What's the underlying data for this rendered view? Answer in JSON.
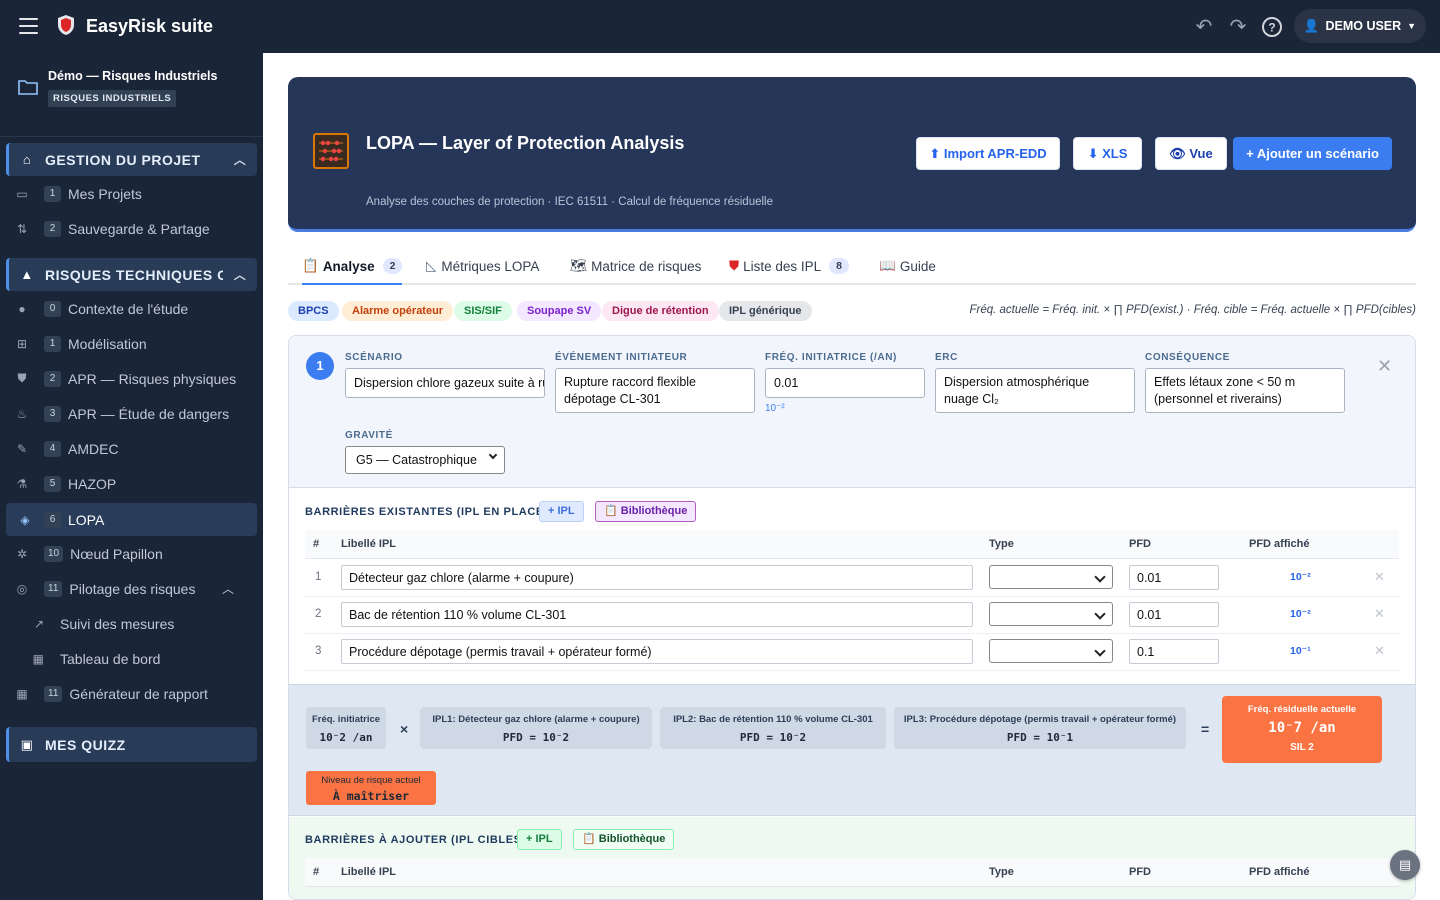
{
  "app": {
    "title": "EasyRisk suite",
    "user": "DEMO USER"
  },
  "project": {
    "name": "Démo — Risques Industriels",
    "badge": "RISQUES INDUSTRIELS"
  },
  "sidebar": {
    "sec1": "GESTION DU PROJET",
    "sec1_items": [
      {
        "num": "1",
        "label": "Mes Projets"
      },
      {
        "num": "2",
        "label": "Sauvegarde & Partage"
      }
    ],
    "sec2": "RISQUES TECHNIQUES O",
    "sec2_items": [
      {
        "num": "0",
        "label": "Contexte de l'étude"
      },
      {
        "num": "1",
        "label": "Modélisation"
      },
      {
        "num": "2",
        "label": "APR — Risques physiques"
      },
      {
        "num": "3",
        "label": "APR — Étude de dangers"
      },
      {
        "num": "4",
        "label": "AMDEC"
      },
      {
        "num": "5",
        "label": "HAZOP"
      },
      {
        "num": "6",
        "label": "LOPA"
      },
      {
        "num": "10",
        "label": "Nœud Papillon"
      },
      {
        "num": "11",
        "label": "Pilotage des risques"
      }
    ],
    "sub_items": [
      "Suivi des mesures",
      "Tableau de bord"
    ],
    "report": {
      "num": "11",
      "label": "Générateur de rapport"
    },
    "sec3": "MES QUIZZ"
  },
  "hero": {
    "title": "LOPA — Layer of Protection Analysis",
    "subtitle": "Analyse des couches de protection · IEC 61511 · Calcul de fréquence résiduelle",
    "buttons": {
      "import": "⬆ Import APR-EDD",
      "xls": "⬇ XLS",
      "vue": "👁 Vue",
      "add": "+ Ajouter un scénario"
    }
  },
  "tabs": [
    {
      "label": "Analyse",
      "count": "2"
    },
    {
      "label": "Métriques LOPA"
    },
    {
      "label": "Matrice de risques"
    },
    {
      "label": "Liste des IPL",
      "count": "8"
    },
    {
      "label": "Guide"
    }
  ],
  "pills": [
    "BPCS",
    "Alarme opérateur",
    "SIS/SIF",
    "Soupape SV",
    "Digue de rétention",
    "IPL générique"
  ],
  "formula": "Fréq. actuelle = Fréq. init. × ∏ PFD(exist.) · Fréq. cible = Fréq. actuelle × ∏ PFD(cibles)",
  "scenario": {
    "num": "1",
    "labels": {
      "scenario": "SCÉNARIO",
      "event": "ÉVÉNEMENT INITIATEUR",
      "freq": "FRÉQ. INITIATRICE (/AN)",
      "erc": "ERC",
      "cons": "CONSÉQUENCE",
      "grav": "GRAVITÉ"
    },
    "scenario_value": "Dispersion chlore gazeux suite à rupture",
    "event_value": "Rupture raccord flexible dépotage CL-301",
    "freq_value": "0.01",
    "freq_hint": "10⁻²",
    "erc_value": "Dispersion atmosphérique nuage Cl₂",
    "cons_value": "Effets létaux zone < 50 m (personnel et riverains)",
    "grav_value": "G5 — Catastrophique"
  },
  "existing": {
    "title": "BARRIÈRES EXISTANTES (IPL EN PLACE)",
    "btn_ipl": "+ IPL",
    "btn_lib": "📋 Bibliothèque",
    "headers": {
      "num": "#",
      "label": "Libellé IPL",
      "type": "Type",
      "pfd": "PFD",
      "aff": "PFD affiché"
    },
    "rows": [
      {
        "n": "1",
        "label": "Détecteur gaz chlore (alarme + coupure)",
        "pfd": "0.01",
        "aff": "10⁻²"
      },
      {
        "n": "2",
        "label": "Bac de rétention 110 % volume CL-301",
        "pfd": "0.01",
        "aff": "10⁻²"
      },
      {
        "n": "3",
        "label": "Procédure dépotage (permis travail + opérateur formé)",
        "pfd": "0.1",
        "aff": "10⁻¹"
      }
    ]
  },
  "calc": {
    "init": {
      "t": "Fréq. initiatrice",
      "v": "10⁻2 /an"
    },
    "ipl1": {
      "t": "IPL1: Détecteur gaz chlore (alarme + coupure)",
      "v": "PFD = 10⁻2"
    },
    "ipl2": {
      "t": "IPL2: Bac de rétention 110 % volume CL-301",
      "v": "PFD = 10⁻2"
    },
    "ipl3": {
      "t": "IPL3: Procédure dépotage (permis travail + opérateur formé)",
      "v": "PFD = 10⁻1"
    },
    "times": "×",
    "equals": "=",
    "result": {
      "t": "Fréq. résiduelle actuelle",
      "v": "10⁻7 /an",
      "s": "SIL 2"
    },
    "level": {
      "t": "Niveau de risque actuel",
      "v": "À maîtriser"
    }
  },
  "target": {
    "title": "BARRIÈRES À AJOUTER (IPL CIBLES)",
    "btn_ipl": "+ IPL",
    "btn_lib": "📋 Bibliothèque",
    "headers": {
      "num": "#",
      "label": "Libellé IPL",
      "type": "Type",
      "pfd": "PFD",
      "aff": "PFD affiché"
    }
  },
  "colors": {
    "topbar": "#1b2538",
    "hero": "#263659",
    "accent": "#3b7cf0",
    "result": "#f97343"
  }
}
